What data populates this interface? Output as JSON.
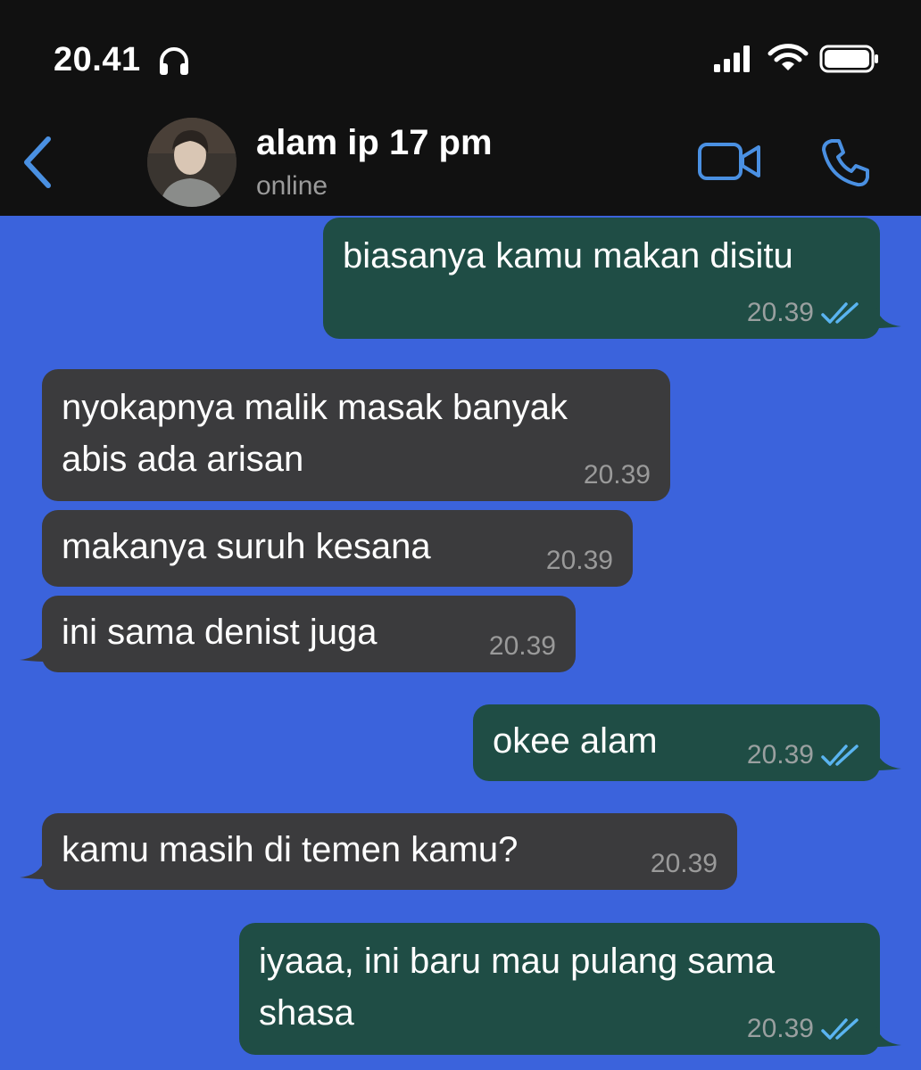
{
  "status_bar": {
    "time": "20.41"
  },
  "header": {
    "contact_name": "alam ip 17 pm",
    "contact_status": "online"
  },
  "colors": {
    "chat_background": "#3b63dc",
    "outgoing_bubble": "#1f4d45",
    "incoming_bubble": "#3b3b3d",
    "accent_blue": "#4a90e2",
    "read_tick": "#5ab4f0"
  },
  "icons": {
    "back": "chevron-left-icon",
    "video": "video-camera-icon",
    "call": "phone-icon",
    "read": "double-check-icon"
  },
  "messages": [
    {
      "direction": "outgoing",
      "lines": [
        "biasanya kamu makan disitu"
      ],
      "time": "20.39",
      "read": true
    },
    {
      "direction": "incoming",
      "lines": [
        "nyokapnya malik masak banyak",
        "abis ada arisan"
      ],
      "time": "20.39"
    },
    {
      "direction": "incoming",
      "lines": [
        "makanya suruh kesana"
      ],
      "time": "20.39"
    },
    {
      "direction": "incoming",
      "lines": [
        "ini sama denist juga"
      ],
      "time": "20.39"
    },
    {
      "direction": "outgoing",
      "lines": [
        "okee alam"
      ],
      "time": "20.39",
      "read": true
    },
    {
      "direction": "incoming",
      "lines": [
        "kamu masih di temen kamu?"
      ],
      "time": "20.39"
    },
    {
      "direction": "outgoing",
      "lines": [
        "iyaaa, ini baru mau pulang sama",
        "shasa"
      ],
      "time": "20.39",
      "read": true
    }
  ]
}
